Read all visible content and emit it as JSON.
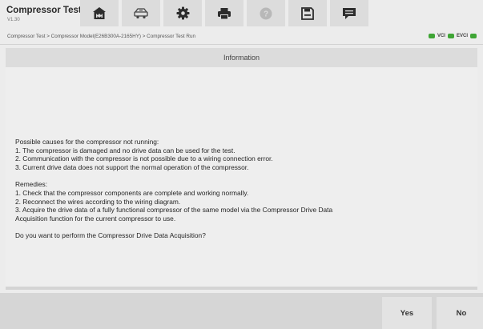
{
  "app": {
    "title": "Compressor Test",
    "version": "V1.30"
  },
  "toolbar": {
    "buttons": [
      {
        "name": "home-button",
        "icon": "home-icon"
      },
      {
        "name": "vehicle-swap-button",
        "icon": "vehicle-swap-icon"
      },
      {
        "name": "settings-button",
        "icon": "gear-icon"
      },
      {
        "name": "print-button",
        "icon": "printer-icon"
      },
      {
        "name": "help-button",
        "icon": "help-icon"
      },
      {
        "name": "save-button",
        "icon": "save-icon"
      },
      {
        "name": "message-button",
        "icon": "message-icon"
      }
    ]
  },
  "breadcrumb": "Compressor Test > Compressor Model(E26B300A-2165HY) > Compressor Test Run",
  "status": {
    "vci_label": "VCI",
    "evci_label": "EVCI",
    "connected_color": "#3fa535"
  },
  "panel": {
    "title": "Information",
    "causes_heading": "Possible causes for the compressor not running:",
    "causes": [
      "1. The compressor is damaged and no drive data can be used for the test.",
      "2. Communication with the compressor is not possible due to a wiring connection error.",
      "3. Current drive data does not support the normal operation of the compressor."
    ],
    "remedies_heading": "Remedies:",
    "remedies": [
      "1. Check that the compressor components are complete and working normally.",
      "2. Reconnect the wires according to the wiring diagram.",
      "3. Acquire the drive data of a fully functional compressor of the same model via the Compressor Drive Data",
      "Acquisition function for the current compressor to use."
    ],
    "question": "Do you want to perform the Compressor Drive Data Acquisition?"
  },
  "footer": {
    "yes_label": "Yes",
    "no_label": "No"
  }
}
